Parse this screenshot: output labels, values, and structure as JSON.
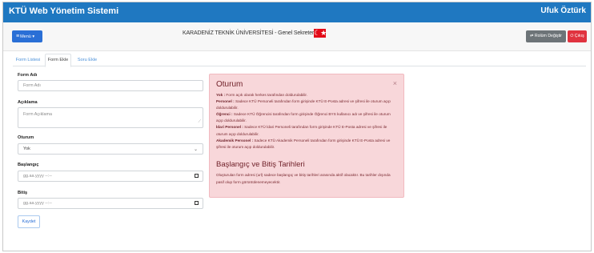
{
  "app": {
    "title": "KTÜ Web Yönetim Sistemi",
    "user": "Ufuk Öztürk"
  },
  "toolbar": {
    "menu_label": "Menü",
    "center_title": "KARADENİZ TEKNİK ÜNİVERSİTESİ - Genel Sekreterlik",
    "flag_symbol": "☾★",
    "switch_role_label": "⇄ Rolüm Değiştir",
    "exit_label": "⏻ Çıkış"
  },
  "tabs": [
    {
      "label": "Form Listesi",
      "active": false
    },
    {
      "label": "Form Ekle",
      "active": true
    },
    {
      "label": "Soru Ekle",
      "active": false
    }
  ],
  "form": {
    "name_label": "Form Adı",
    "name_placeholder": "Form Adı",
    "desc_label": "Açıklama",
    "desc_placeholder": "Form Açıklama",
    "session_label": "Oturum",
    "session_value": "Yok",
    "start_label": "Başlangıç",
    "start_placeholder": "gg.aa.yyyy --:--",
    "end_label": "Bitiş",
    "end_placeholder": "gg.aa.yyyy --:--",
    "save_label": "Kaydet"
  },
  "alert": {
    "title1": "Oturum",
    "close": "×",
    "items": [
      {
        "key": "Yok :",
        "text": " Form açık olarak herkes tarafından doldurulabilir."
      },
      {
        "key": "Personel :",
        "text": " Sadece KTÜ Personeli tarafından form girişinde KTÜ E-Posta adresi ve şifresi ile oturum açıp doldurulabilir."
      },
      {
        "key": "Öğrenci :",
        "text": " Sadece KTÜ Öğrencisi tarafından form girişinde Öğrenci BYS kullanıcı adı ve şifresi ile oturum açıp doldurulabilir."
      },
      {
        "key": "İdari Personel :",
        "text": " Sadece KTÜ İdari Personeli tarafından form girişinde KTÜ E-Posta adresi ve şifresi ile oturum açıp doldurulabilir."
      },
      {
        "key": "Akademik Personel :",
        "text": " Sadece KTÜ Akademik Personeli tarafından form girişinde KTÜ E-Posta adresi ve şifresi ile oturum açıp doldurulabilir."
      }
    ],
    "title2": "Başlangıç ve Bitiş Tarihleri",
    "dates_text": "Oluşturulan form adresi (url) sadece başlangıç ve bitiş tarihleri arasında aktif olacaktır. Bu tarihler dışında pasif olup form görüntülenemeyecektir."
  },
  "colors": {
    "brand": "#1f78c1",
    "alert_bg": "#f8d7da",
    "danger": "#e0333f"
  }
}
